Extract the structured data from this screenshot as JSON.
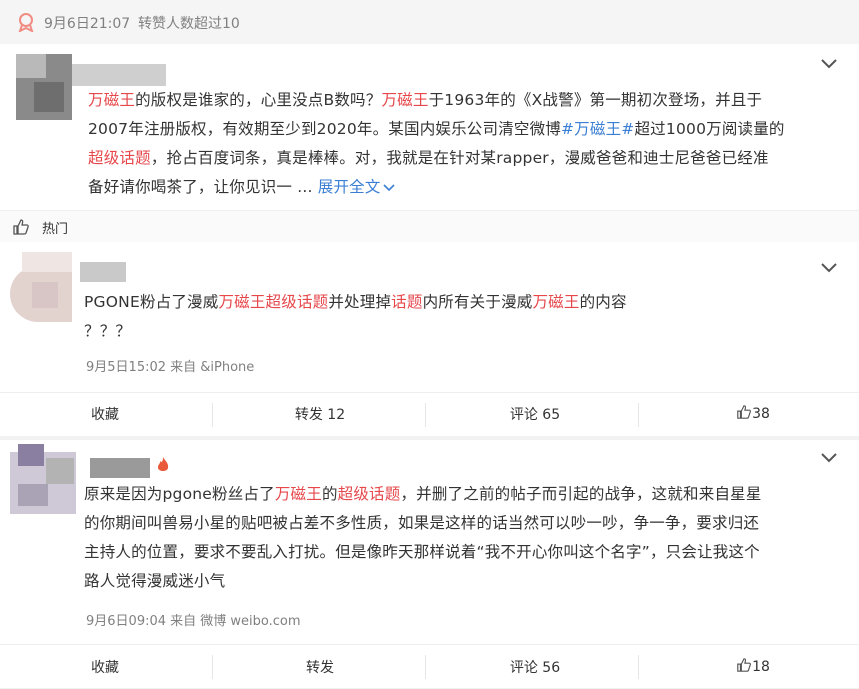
{
  "top_bar": {
    "time": "9月6日21:07",
    "note": "转赞人数超过10"
  },
  "main_post": {
    "p1_a": "万磁王",
    "p1_b": "的版权是谁家的，心里没点B数吗？",
    "p1_c": "万磁王",
    "p1_d": "于1963年的《X战警》第一期初次登场，并且于",
    "p2": "2007年注册版权，有效期至少到2020年。某国内娱乐公司清空微博",
    "p2_tag": "#万磁王#",
    "p2_b": "超过1000万阅读量的",
    "p3_a": "超级话题",
    "p3_b": "，抢占百度词条，真是棒棒。对，我就是在针对某rapper，漫威爸爸和迪士尼爸爸已经准",
    "p4": "备好请你喝茶了，让你见识一",
    "ellipsis": "...",
    "expand": "展开全文"
  },
  "hot_label": "热门",
  "comments": [
    {
      "text_a": "PGONE粉占了漫威",
      "text_b": "万磁王超级话题",
      "text_c": "并处理掉",
      "text_d": "话题",
      "text_e": "内所有关于漫威",
      "text_f": "万磁王",
      "text_g": "的内容",
      "line2": "？？？",
      "meta": "9月5日15:02 来自 &iPhone",
      "actions": {
        "collect": "收藏",
        "repost": "转发 12",
        "comment": "评论 65",
        "like": "38"
      }
    },
    {
      "l1_a": "原来是因为pgone粉丝占了",
      "l1_b": "万磁王",
      "l1_c": "的",
      "l1_d": "超级话题",
      "l1_e": "，并删了之前的帖子而引起的战争，这就和来自星星",
      "l2": "的你期间叫兽易小星的贴吧被占差不多性质，如果是这样的话当然可以吵一吵，争一争，要求归还",
      "l3": "主持人的位置，要求不要乱入打扰。但是像昨天那样说着“我不开心你叫这个名字”，只会让我这个",
      "l4": "路人觉得漫威迷小气",
      "meta": "9月6日09:04 来自 微博 weibo.com",
      "actions": {
        "collect": "收藏",
        "repost": "转发",
        "comment": "评论 56",
        "like": "18"
      }
    }
  ],
  "colors": {
    "highlight": "#e6474b",
    "link": "#3b7fd4",
    "background": "#f2f2f2"
  }
}
